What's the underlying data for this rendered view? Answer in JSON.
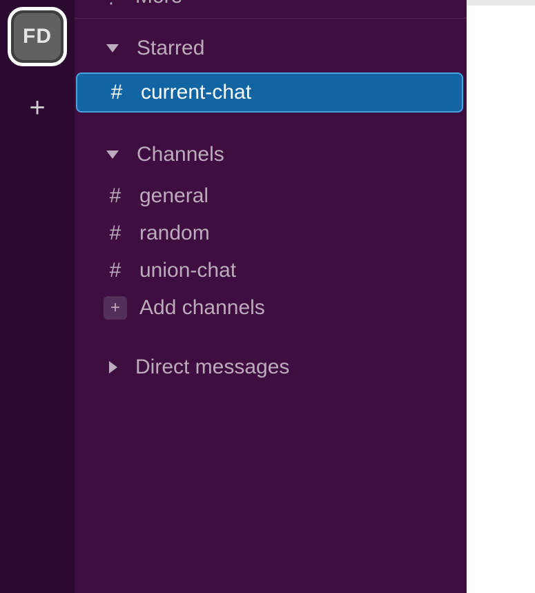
{
  "workspace": {
    "initials": "FD"
  },
  "nav": {
    "more_label": "More"
  },
  "sections": {
    "starred": {
      "label": "Starred",
      "expanded": true,
      "items": [
        {
          "name": "current-chat",
          "selected": true
        }
      ]
    },
    "channels": {
      "label": "Channels",
      "expanded": true,
      "items": [
        {
          "name": "general",
          "selected": false
        },
        {
          "name": "random",
          "selected": false
        },
        {
          "name": "union-chat",
          "selected": false
        }
      ],
      "add_label": "Add channels"
    },
    "direct_messages": {
      "label": "Direct messages",
      "expanded": false
    }
  }
}
